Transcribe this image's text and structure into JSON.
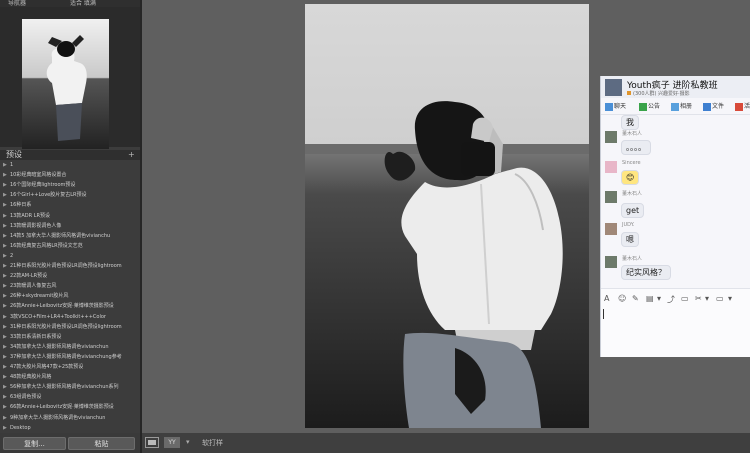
{
  "navigator": {
    "title": "导航器",
    "options": "适合  填满"
  },
  "presets": {
    "title": "预设",
    "plus": "+",
    "items": [
      "1",
      "10彩经典暗室风格设置合",
      "16个国际经典lightroom预设",
      "16个Girl++Love胶片复古LR预设",
      "16种日系",
      "13款ADR LR预设",
      "13款暖调影视调色人像",
      "14款5 加拿大华人摄影师风格调色vivianchu",
      "16款经典复古风格LR预设文艺范",
      "2",
      "21种日系阳光胶片调色预设LR调色预设lightroom",
      "22款AM-LR预设",
      "23款暖调人像复古风",
      "26种+skydreamit胶片风",
      "26款Annie+Leibovitz安妮·莱博维茨摄影预设",
      "3款VSCO+Film+LR4+Toolkit+++Color",
      "31种日系阳光胶片调色预设LR调色预设lightroom",
      "33款日系清新日系预设",
      "34款加拿大华人摄影师风格调色vivianchun",
      "37种加拿大华人摄影师风格调色vivianchung参考",
      "47款大胶片风格47款+25款预设",
      "48款经典胶片风格",
      "56种加拿大华人摄影师风格调色vivianchun系列",
      "63组调色预设",
      "66款Annie+Leibovitz安妮·莱博维茨摄影预设",
      "9种加拿大华人摄影师风格调色vivianchun",
      "Desktop"
    ]
  },
  "left_buttons": {
    "copy": "复制...",
    "paste": "粘贴"
  },
  "toolbar": {
    "view_mode": "YY",
    "soft_proof": "软打样"
  },
  "chat": {
    "group_name": "Youth疯子 进阶私教班",
    "group_sub": "(300人群) 兴趣爱好·摄影",
    "tabs": [
      "聊天",
      "公告",
      "相册",
      "文件",
      "活"
    ],
    "messages": [
      {
        "user": "",
        "text": "我"
      },
      {
        "user": "董木石人",
        "text": "。。。。"
      },
      {
        "user": "Sincere",
        "text": "😊"
      },
      {
        "user": "董木石人",
        "text": "get"
      },
      {
        "user": "JUDY.",
        "text": "嗯"
      },
      {
        "user": "董木石人",
        "text": "纪实风格？"
      }
    ],
    "composer_tools": [
      "A",
      "☺",
      "✎",
      "▤",
      "▾",
      "⤴",
      "▭",
      "✂",
      "▾",
      "▭",
      "▾"
    ]
  },
  "colors": {
    "panel": "#3c3c3c",
    "workspace": "#5f5f5f",
    "chat_bg": "#f6f6fa",
    "bubble": "#eaecf2"
  }
}
